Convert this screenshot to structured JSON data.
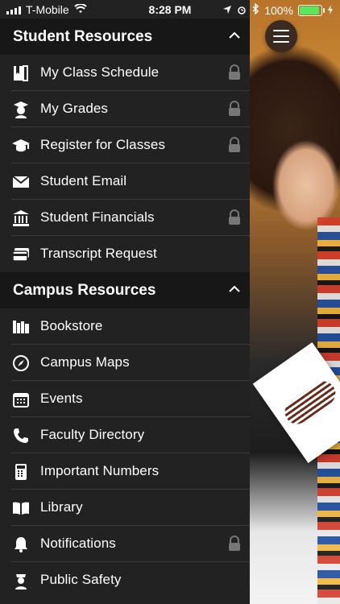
{
  "status_bar": {
    "carrier": "T-Mobile",
    "time": "8:28 PM",
    "battery_percent": "100%",
    "battery_level": 1.0,
    "icons": [
      "signal-icon",
      "wifi-icon",
      "location-arrow-icon",
      "alarm-icon",
      "bluetooth-icon",
      "battery-icon",
      "charging-icon"
    ]
  },
  "menu": {
    "student_resources": {
      "title": "Student Resources",
      "items": [
        {
          "label": "My Class Schedule",
          "icon": "book-icon",
          "locked": true
        },
        {
          "label": "My Grades",
          "icon": "graduate-icon",
          "locked": true
        },
        {
          "label": "Register for Classes",
          "icon": "mortarboard-icon",
          "locked": true
        },
        {
          "label": "Student Email",
          "icon": "envelope-icon",
          "locked": false
        },
        {
          "label": "Student Financials",
          "icon": "bank-icon",
          "locked": true
        },
        {
          "label": "Transcript Request",
          "icon": "credit-card-icon",
          "locked": false
        }
      ]
    },
    "campus_resources": {
      "title": "Campus Resources",
      "items": [
        {
          "label": "Bookstore",
          "icon": "books-icon",
          "locked": false
        },
        {
          "label": "Campus Maps",
          "icon": "compass-icon",
          "locked": false
        },
        {
          "label": "Events",
          "icon": "calendar-icon",
          "locked": false
        },
        {
          "label": "Faculty Directory",
          "icon": "phone-icon",
          "locked": false
        },
        {
          "label": "Important Numbers",
          "icon": "calculator-icon",
          "locked": false
        },
        {
          "label": "Library",
          "icon": "open-book-icon",
          "locked": false
        },
        {
          "label": "Notifications",
          "icon": "bell-icon",
          "locked": true
        },
        {
          "label": "Public Safety",
          "icon": "police-icon",
          "locked": false
        }
      ]
    }
  },
  "colors": {
    "menu_bg": "#222222",
    "header_bg": "#171717",
    "text": "#ffffff",
    "separator": "#3a3a3a",
    "battery_fill": "#5ce65c"
  }
}
